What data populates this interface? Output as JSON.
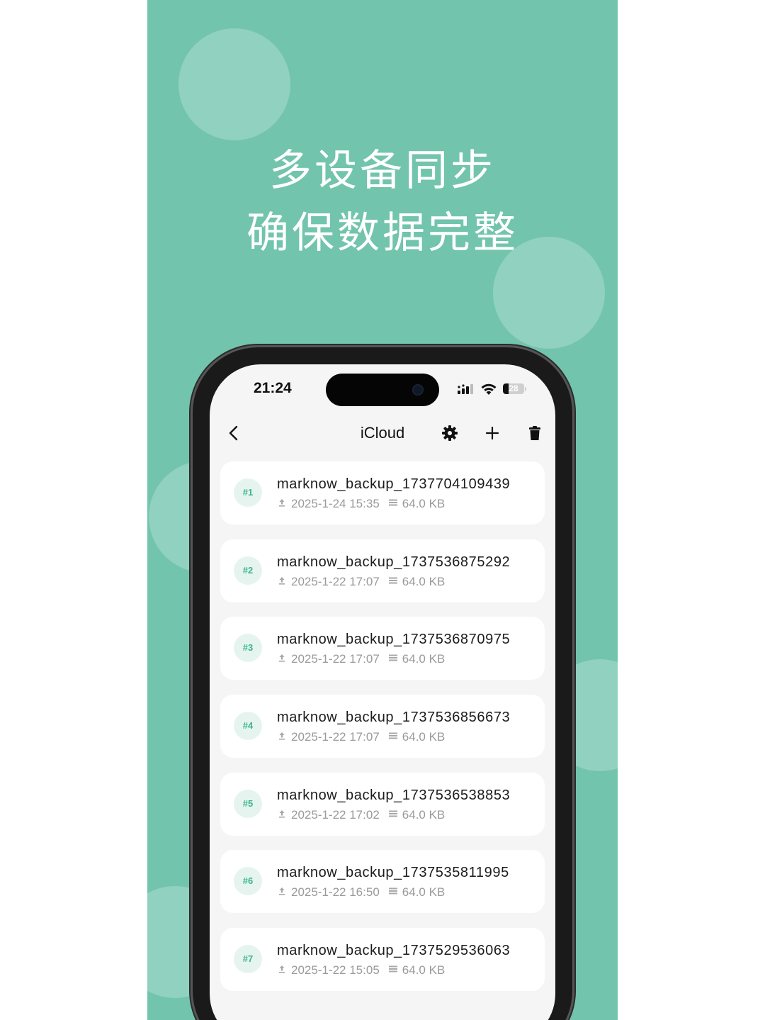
{
  "poster": {
    "headline_line1": "多设备同步",
    "headline_line2": "确保数据完整",
    "background_color": "#72c4ad"
  },
  "status_bar": {
    "time": "21:24",
    "battery_level": "28",
    "battery_fraction": 0.28,
    "icons": [
      "cellular-signal-icon",
      "wifi-icon",
      "battery-icon"
    ]
  },
  "navbar": {
    "title": "iCloud",
    "icons": [
      "chevron-left-icon",
      "gear-icon",
      "plus-icon",
      "trash-icon"
    ]
  },
  "backups": [
    {
      "index": "#1",
      "name": "marknow_backup_1737704109439",
      "date": "2025-1-24 15:35",
      "size": "64.0 KB"
    },
    {
      "index": "#2",
      "name": "marknow_backup_1737536875292",
      "date": "2025-1-22 17:07",
      "size": "64.0 KB"
    },
    {
      "index": "#3",
      "name": "marknow_backup_1737536870975",
      "date": "2025-1-22 17:07",
      "size": "64.0 KB"
    },
    {
      "index": "#4",
      "name": "marknow_backup_1737536856673",
      "date": "2025-1-22 17:07",
      "size": "64.0 KB"
    },
    {
      "index": "#5",
      "name": "marknow_backup_1737536538853",
      "date": "2025-1-22 17:02",
      "size": "64.0 KB"
    },
    {
      "index": "#6",
      "name": "marknow_backup_1737535811995",
      "date": "2025-1-22 16:50",
      "size": "64.0 KB"
    },
    {
      "index": "#7",
      "name": "marknow_backup_1737529536063",
      "date": "2025-1-22 15:05",
      "size": "64.0 KB"
    }
  ],
  "accent_color": "#3cb58f"
}
